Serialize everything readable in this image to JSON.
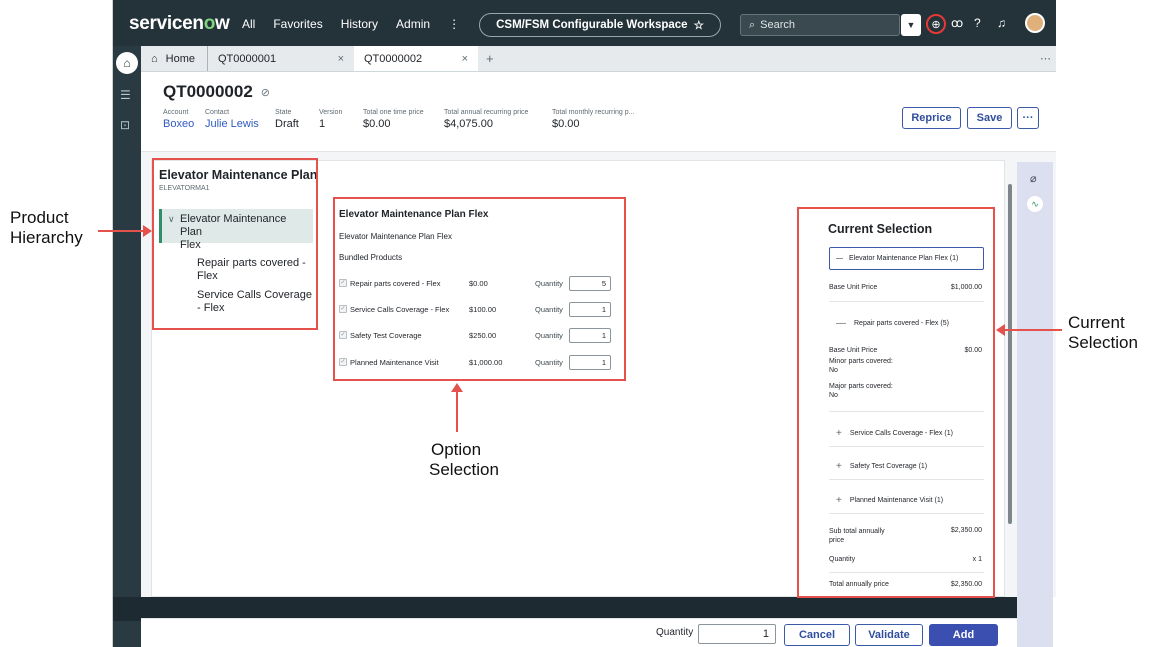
{
  "topbar": {
    "logo_pre": "servicen",
    "logo_o": "o",
    "logo_post": "w",
    "nav": [
      "All",
      "Favorites",
      "History",
      "Admin",
      "⋮"
    ],
    "scope": "CSM/FSM Configurable Workspace",
    "search_placeholder": "Search"
  },
  "tabs": {
    "home": "Home",
    "tab1": "QT0000001",
    "tab2": "QT0000002",
    "close": "×",
    "plus": "+",
    "more": "⋯"
  },
  "record": {
    "title": "QT0000002",
    "fields": [
      {
        "label": "Account",
        "value": "Boxeo"
      },
      {
        "label": "Contact",
        "value": "Julie Lewis"
      },
      {
        "label": "State",
        "value": "Draft"
      },
      {
        "label": "Version",
        "value": "1"
      },
      {
        "label": "Total one time price",
        "value": "$0.00"
      },
      {
        "label": "Total annual recurring price",
        "value": "$4,075.00"
      },
      {
        "label": "Total monthly recurring p...",
        "value": "$0.00"
      }
    ],
    "reprice": "Reprice",
    "save": "Save",
    "more": "···"
  },
  "hierarchy": {
    "title": "Elevator Maintenance Plan",
    "code": "ELEVATORMA1",
    "selected_line1": "Elevator Maintenance Plan",
    "selected_line2": "Flex",
    "child1_line1": "Repair parts covered -",
    "child1_line2": "Flex",
    "child2_line1": "Service Calls Coverage",
    "child2_line2": "- Flex"
  },
  "options": {
    "title": "Elevator Maintenance Plan Flex",
    "subtitle": "Elevator Maintenance Plan Flex",
    "bundled": "Bundled Products",
    "quantity_label": "Quantity",
    "rows": [
      {
        "name": "Repair parts covered - Flex",
        "price": "$0.00",
        "qty": "5"
      },
      {
        "name": "Service Calls Coverage - Flex",
        "price": "$100.00",
        "qty": "1"
      },
      {
        "name": "Safety Test Coverage",
        "price": "$250.00",
        "qty": "1"
      },
      {
        "name": "Planned Maintenance Visit",
        "price": "$1,000.00",
        "qty": "1"
      }
    ]
  },
  "selection": {
    "title": "Current Selection",
    "main": "Elevator Maintenance Plan Flex (1)",
    "base_unit_price_label": "Base Unit Price",
    "base_unit_price": "$1,000.00",
    "repair": "Repair parts covered - Flex (5)",
    "repair_base_price": "$0.00",
    "minor_label": "Minor parts covered:",
    "minor_value": "No",
    "major_label": "Major parts covered:",
    "major_value": "No",
    "service": "Service Calls Coverage - Flex (1)",
    "safety": "Safety Test Coverage (1)",
    "planned": "Planned Maintenance Visit (1)",
    "subtotal_label_1": "Sub total annually",
    "subtotal_label_2": "price",
    "subtotal": "$2,350.00",
    "quantity_label": "Quantity",
    "quantity": "x 1",
    "total_label": "Total annually price",
    "total": "$2,350.00"
  },
  "footer": {
    "quantity_label": "Quantity",
    "quantity": "1",
    "cancel": "Cancel",
    "validate": "Validate",
    "add": "Add"
  },
  "annotations": {
    "hierarchy_1": "Product",
    "hierarchy_2": "Hierarchy",
    "option_1": "Option",
    "option_2": "Selection",
    "current_1": "Current",
    "current_2": "Selection"
  },
  "colors": {
    "topbar": "#243239",
    "accent": "#3b5aa8",
    "annotation": "#e5514b",
    "selected_green": "#2f8f6b"
  }
}
